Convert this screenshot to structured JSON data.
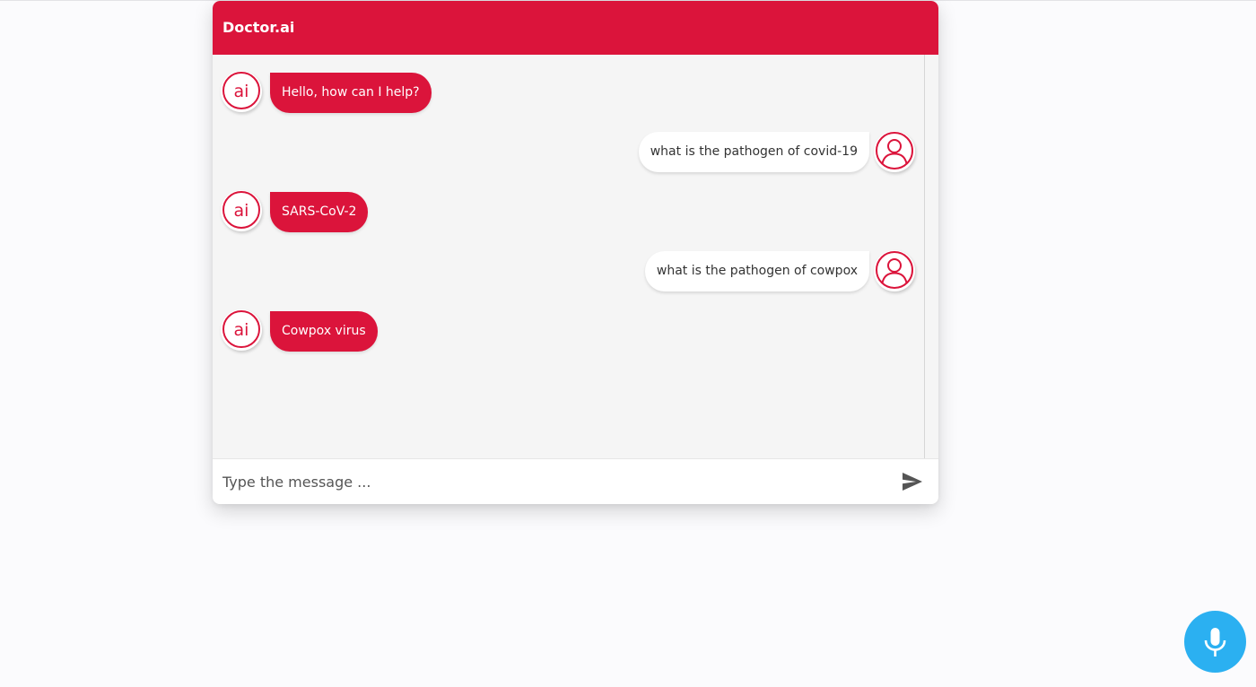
{
  "app": {
    "title": "Doctor.ai"
  },
  "colors": {
    "brand": "#db143b",
    "mic": "#2bb0f1"
  },
  "messages": [
    {
      "sender": "bot",
      "text": "Hello, how can I help?",
      "avatar_icon": "ai-logo-icon"
    },
    {
      "sender": "user",
      "text": "what is the pathogen of covid-19",
      "avatar_icon": "user-icon"
    },
    {
      "sender": "bot",
      "text": "SARS-CoV-2",
      "avatar_icon": "ai-logo-icon"
    },
    {
      "sender": "user",
      "text": "what is the pathogen of cowpox",
      "avatar_icon": "user-icon"
    },
    {
      "sender": "bot",
      "text": "Cowpox virus",
      "avatar_icon": "ai-logo-icon"
    }
  ],
  "composer": {
    "placeholder": "Type the message ...",
    "send_icon": "send-icon"
  },
  "voice": {
    "icon": "microphone-icon"
  }
}
